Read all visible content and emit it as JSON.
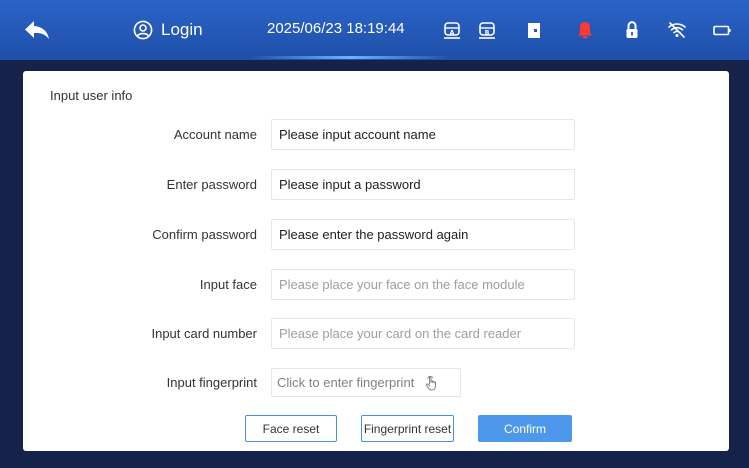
{
  "header": {
    "login_label": "Login",
    "datetime": "2025/06/23 18:19:44",
    "icons": [
      "back-arrow-icon",
      "user-circle-icon",
      "bus-a-icon",
      "bus-b-icon",
      "door-icon",
      "alarm-bell-icon",
      "lock-icon",
      "wifi-off-icon",
      "battery-icon"
    ],
    "alarm_color": "#ff3b30"
  },
  "form": {
    "title": "Input user info",
    "account": {
      "label": "Account name",
      "placeholder": "Please input account name"
    },
    "password": {
      "label": "Enter password",
      "placeholder": "Please input a password"
    },
    "confirm_password": {
      "label": "Confirm password",
      "placeholder": "Please enter the password again"
    },
    "face": {
      "label": "Input face",
      "placeholder": "Please place your face on the face module"
    },
    "card": {
      "label": "Input card number",
      "placeholder": "Please place your card on the card reader"
    },
    "fingerprint": {
      "label": "Input fingerprint",
      "button_text": "Click to enter fingerprint"
    }
  },
  "actions": {
    "face_reset": "Face reset",
    "fingerprint_reset": "Fingerprint reset",
    "confirm": "Confirm"
  }
}
